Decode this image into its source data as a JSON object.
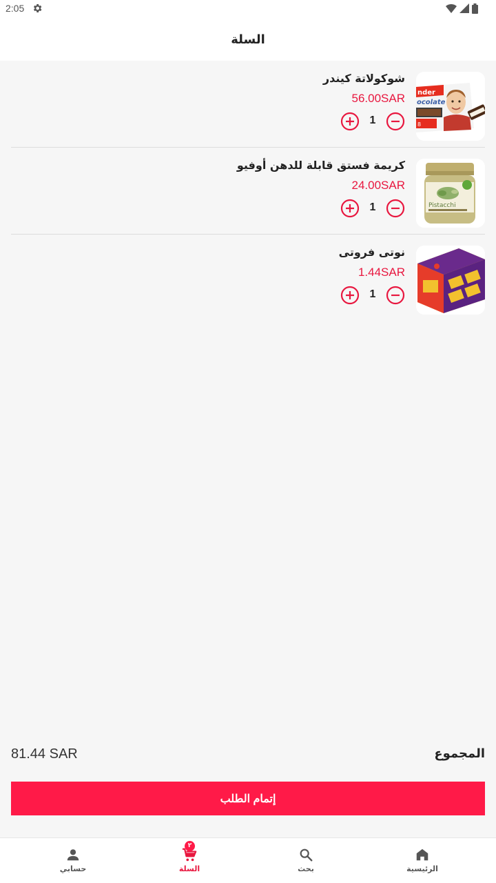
{
  "status_bar": {
    "time": "2:05"
  },
  "header": {
    "title": "السلة"
  },
  "cart": {
    "items": [
      {
        "name": "شوكولاتة كيندر",
        "price": "56.00SAR",
        "quantity": "1",
        "image": "kinder-chocolate-product-image"
      },
      {
        "name": "كريمة فستق قابلة للدهن أوفيو",
        "price": "24.00SAR",
        "quantity": "1",
        "image": "pistachio-cream-jar-product-image"
      },
      {
        "name": "نوتى فروتى",
        "price": "1.44SAR",
        "quantity": "1",
        "image": "noty-fruity-box-product-image"
      }
    ]
  },
  "summary": {
    "total_label": "المجموع",
    "total_value": "81.44 SAR"
  },
  "checkout": {
    "label": "إتمام الطلب"
  },
  "bottom_nav": {
    "items": [
      {
        "label": "حسابي",
        "icon": "person-icon"
      },
      {
        "label": "السلة",
        "icon": "cart-icon",
        "badge": "٢",
        "active": true
      },
      {
        "label": "بحث",
        "icon": "search-icon"
      },
      {
        "label": "الرئيسية",
        "icon": "home-icon"
      }
    ]
  },
  "colors": {
    "accent": "#ff1a48",
    "price": "#e8173f",
    "background": "#f6f6f6"
  }
}
